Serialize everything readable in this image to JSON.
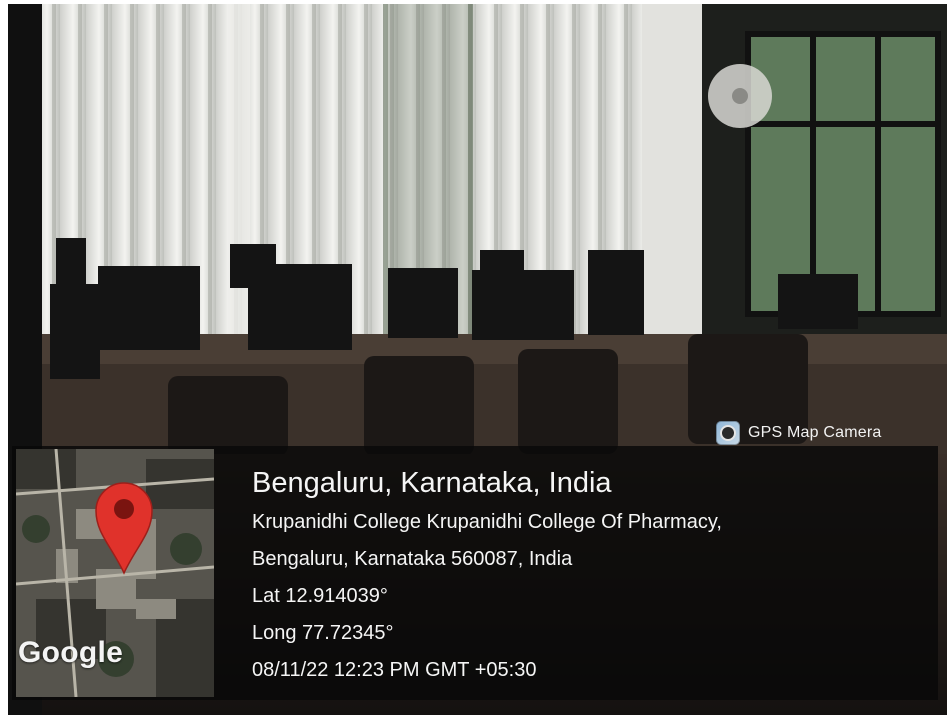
{
  "app_badge": {
    "icon": "camera-app-icon",
    "label": "GPS Map Camera"
  },
  "map": {
    "icon": "map-pin-icon",
    "brand": "Google"
  },
  "location": {
    "headline": "Bengaluru, Karnataka, India",
    "address_line_1": "Krupanidhi College Krupanidhi College Of Pharmacy,",
    "address_line_2": "Bengaluru, Karnataka 560087, India",
    "latitude": "Lat 12.914039°",
    "longitude": "Long 77.72345°",
    "timestamp": "08/11/22 12:23 PM GMT +05:30"
  },
  "colors": {
    "pin": "#e0322b",
    "panel": "#080808"
  }
}
